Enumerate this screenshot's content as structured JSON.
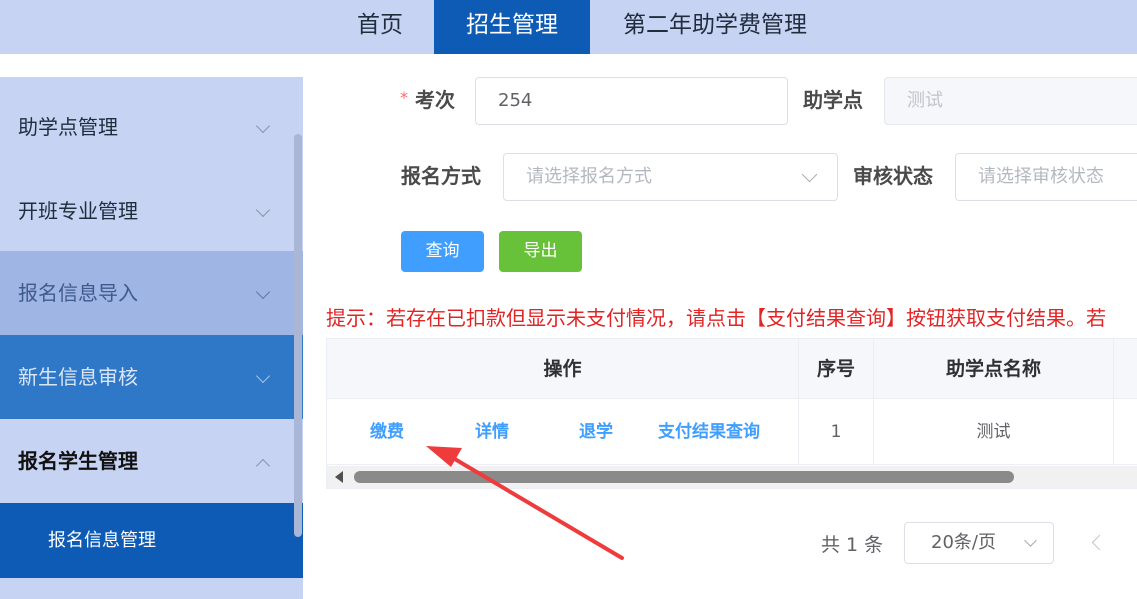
{
  "topnav": {
    "items": [
      {
        "label": "首页",
        "active": false
      },
      {
        "label": "招生管理",
        "active": true
      },
      {
        "label": "第二年助学费管理",
        "active": false
      }
    ]
  },
  "sidebar": {
    "items": [
      {
        "label": "助学点管理",
        "expanded": false
      },
      {
        "label": "开班专业管理",
        "expanded": false
      },
      {
        "label": "报名信息导入",
        "expanded": false
      },
      {
        "label": "新生信息审核",
        "expanded": false
      },
      {
        "label": "报名学生管理",
        "expanded": true
      }
    ],
    "subitem": {
      "label": "报名信息管理",
      "selected": true
    }
  },
  "form": {
    "required_mark": "*",
    "exam_label": "考次",
    "exam_value": "254",
    "point_label": "助学点",
    "point_value": "测试",
    "method_label": "报名方式",
    "method_placeholder": "请选择报名方式",
    "status_label": "审核状态",
    "status_placeholder": "请选择审核状态"
  },
  "buttons": {
    "query": "查询",
    "export": "导出"
  },
  "tip": "提示：若存在已扣款但显示未支付情况，请点击【支付结果查询】按钮获取支付结果。若",
  "table": {
    "headers": [
      "操作",
      "序号",
      "助学点名称"
    ],
    "rows": [
      {
        "actions": [
          "缴费",
          "详情",
          "退学",
          "支付结果查询"
        ],
        "index": "1",
        "point_name": "测试"
      }
    ]
  },
  "pagination": {
    "total": "共 1 条",
    "page_size": "20条/页"
  },
  "colors": {
    "accent": "#409eff",
    "nav_active": "#0e5bb5",
    "success": "#67c23a",
    "danger": "#e22424",
    "nav_bg": "#c7d3f3"
  }
}
